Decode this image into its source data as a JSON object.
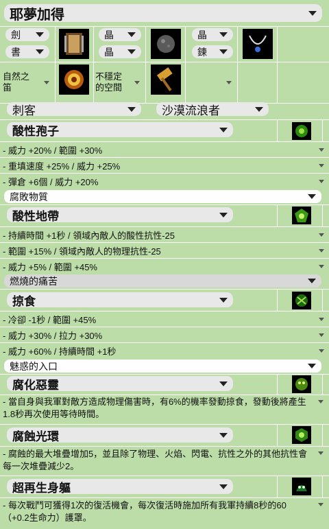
{
  "header": {
    "title": "耶夢加得"
  },
  "equip": {
    "row1": [
      {
        "label": "劍",
        "icon": "chest-armor-icon"
      },
      {
        "label": "晶",
        "icon": "stone-orb-icon"
      },
      {
        "label": "晶",
        "icon": "pendant-necklace-icon"
      }
    ],
    "row2": [
      {
        "label": "書"
      },
      {
        "label": "晶"
      },
      {
        "label": "鍊"
      }
    ],
    "row3": [
      {
        "label": "自然之\n笛",
        "icon": "amber-shield-icon"
      },
      {
        "label": "不穩定\n的空間",
        "icon": "golden-hammer-icon"
      },
      {
        "label": ""
      }
    ]
  },
  "classes": {
    "left": "刺客",
    "right": "沙漠流浪者"
  },
  "skills": [
    {
      "name": "酸性孢子",
      "icon": "acid-spore-icon",
      "mods": [
        "- 威力 +20% / 範圍 +30%",
        "- 重填速度 +25% / 威力 +25%",
        "- 彈倉 +6個 / 威力 +20%"
      ],
      "rune": "腐敗物質"
    },
    {
      "name": "酸性地帶",
      "icon": "acid-zone-icon",
      "mods": [
        "- 持續時間 +1秒 / 領域內敵人的酸性抗性-25",
        "- 範圍 +15% / 領域內敵人的物理抗性-25",
        "- 威力 +5% / 範圍 +45%"
      ],
      "rune": "燃燒的痛苦"
    },
    {
      "name": "掠食",
      "icon": "predation-icon",
      "mods": [
        "- 冷卻 -1秒 / 範圍 +45%",
        "- 威力 +30% / 拉力 +30%",
        "- 威力 +60% / 持續時間 +1秒"
      ],
      "rune": "魅惑的入口"
    }
  ],
  "passives": [
    {
      "name": "腐化惡靈",
      "icon": "corrupt-spirit-icon",
      "desc": "- 當自身與我軍對敵方造成物理傷害時，有6%的機率發動掠食，發動後將產生1.8秒再次使用等待時間。"
    },
    {
      "name": "腐蝕光環",
      "icon": "corrosion-aura-icon",
      "desc": "- 腐蝕的最大堆疊增加5，並且除了物理、火焰、閃電、抗性之外的其他抗性會每一次堆疊減少2。"
    },
    {
      "name": "超再生身軀",
      "icon": "regen-body-icon",
      "desc": "- 每次戰鬥可獲得1次的復活機會，每次復活時施加所有我軍持續8秒的60（+0.2生命力）護罩。"
    }
  ]
}
